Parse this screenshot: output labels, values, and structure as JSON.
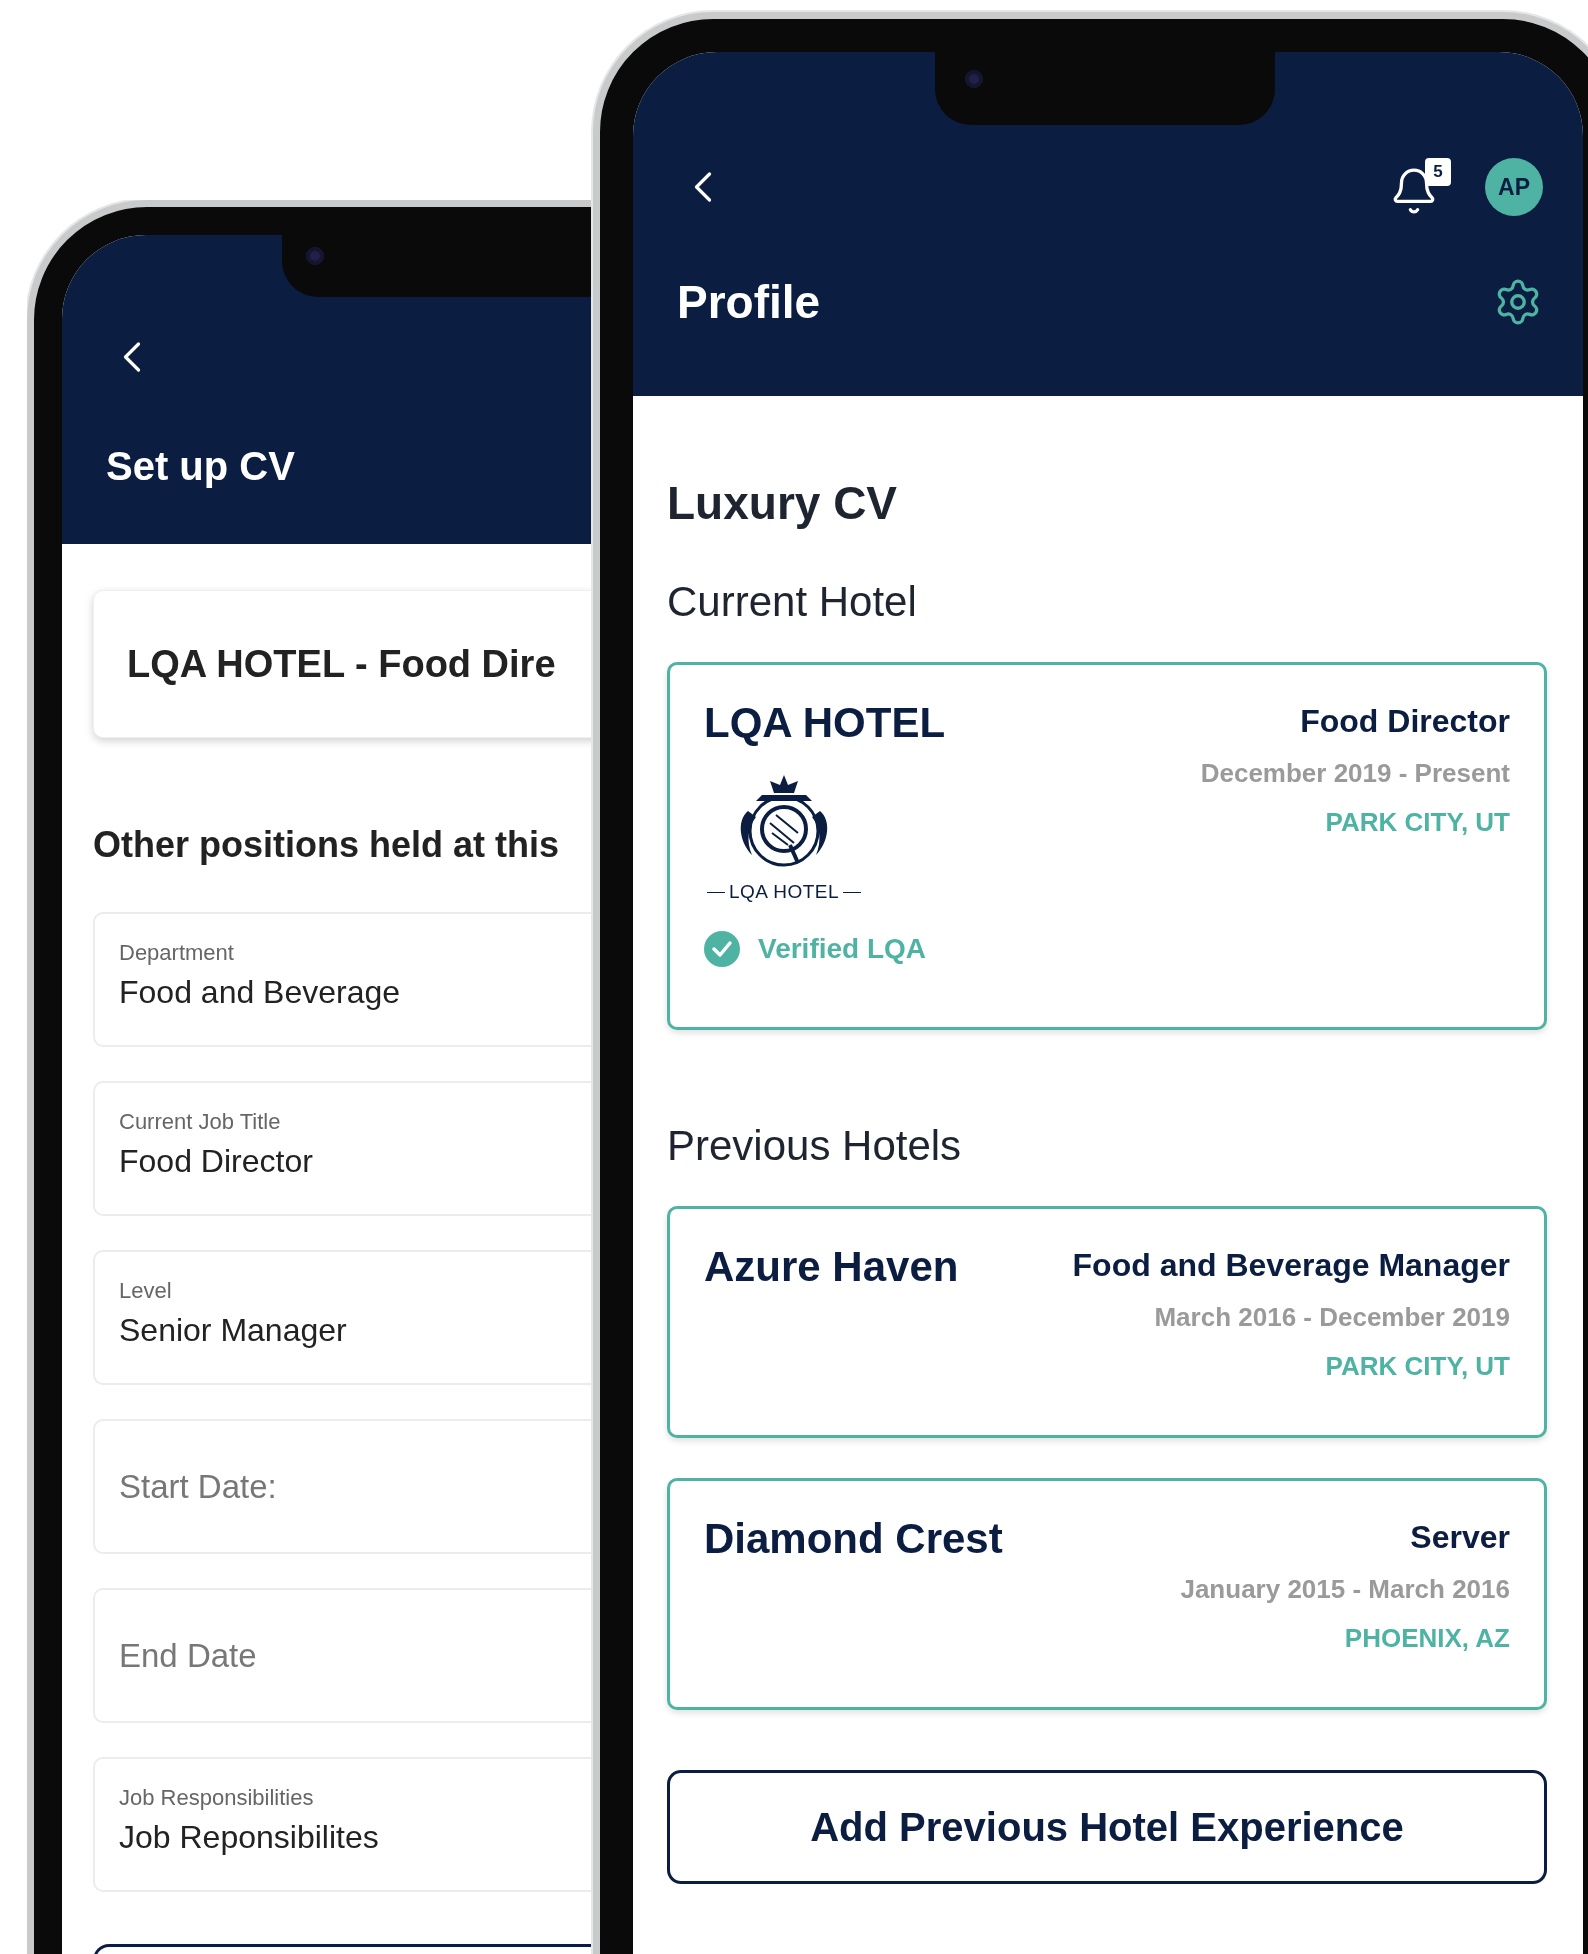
{
  "back_phone": {
    "header": {
      "title": "Set up CV"
    },
    "position_card": {
      "title": "LQA HOTEL - Food Dire"
    },
    "section_title": "Other positions held at this",
    "fields": [
      {
        "kind": "filled",
        "label": "Department",
        "value": "Food and Beverage"
      },
      {
        "kind": "filled",
        "label": "Current Job Title",
        "value": "Food Director"
      },
      {
        "kind": "filled",
        "label": "Level",
        "value": "Senior Manager"
      },
      {
        "kind": "empty",
        "placeholder": "Start Date:"
      },
      {
        "kind": "empty",
        "placeholder": "End Date"
      },
      {
        "kind": "filled",
        "label": "Job Responsibilities",
        "value": "Job Reponsibilites"
      }
    ]
  },
  "front_phone": {
    "header": {
      "title": "Profile",
      "notification_count": "5",
      "avatar_initials": "AP"
    },
    "page_title": "Luxury CV",
    "current_section": {
      "title": "Current Hotel",
      "hotel": {
        "name": "LQA HOTEL",
        "role": "Food Director",
        "dates": "December 2019 - Present",
        "location": "PARK CITY, UT",
        "logo_caption": "LQA HOTEL",
        "verified": true,
        "verified_label": "Verified LQA"
      }
    },
    "previous_section": {
      "title": "Previous Hotels",
      "hotels": [
        {
          "name": "Azure Haven",
          "role": "Food and Beverage Manager",
          "dates": "March 2016 - December 2019",
          "location": "PARK CITY, UT"
        },
        {
          "name": "Diamond Crest",
          "role": "Server",
          "dates": "January 2015 - March 2016",
          "location": "PHOENIX, AZ"
        }
      ]
    },
    "add_button": "Add Previous Hotel Experience"
  }
}
